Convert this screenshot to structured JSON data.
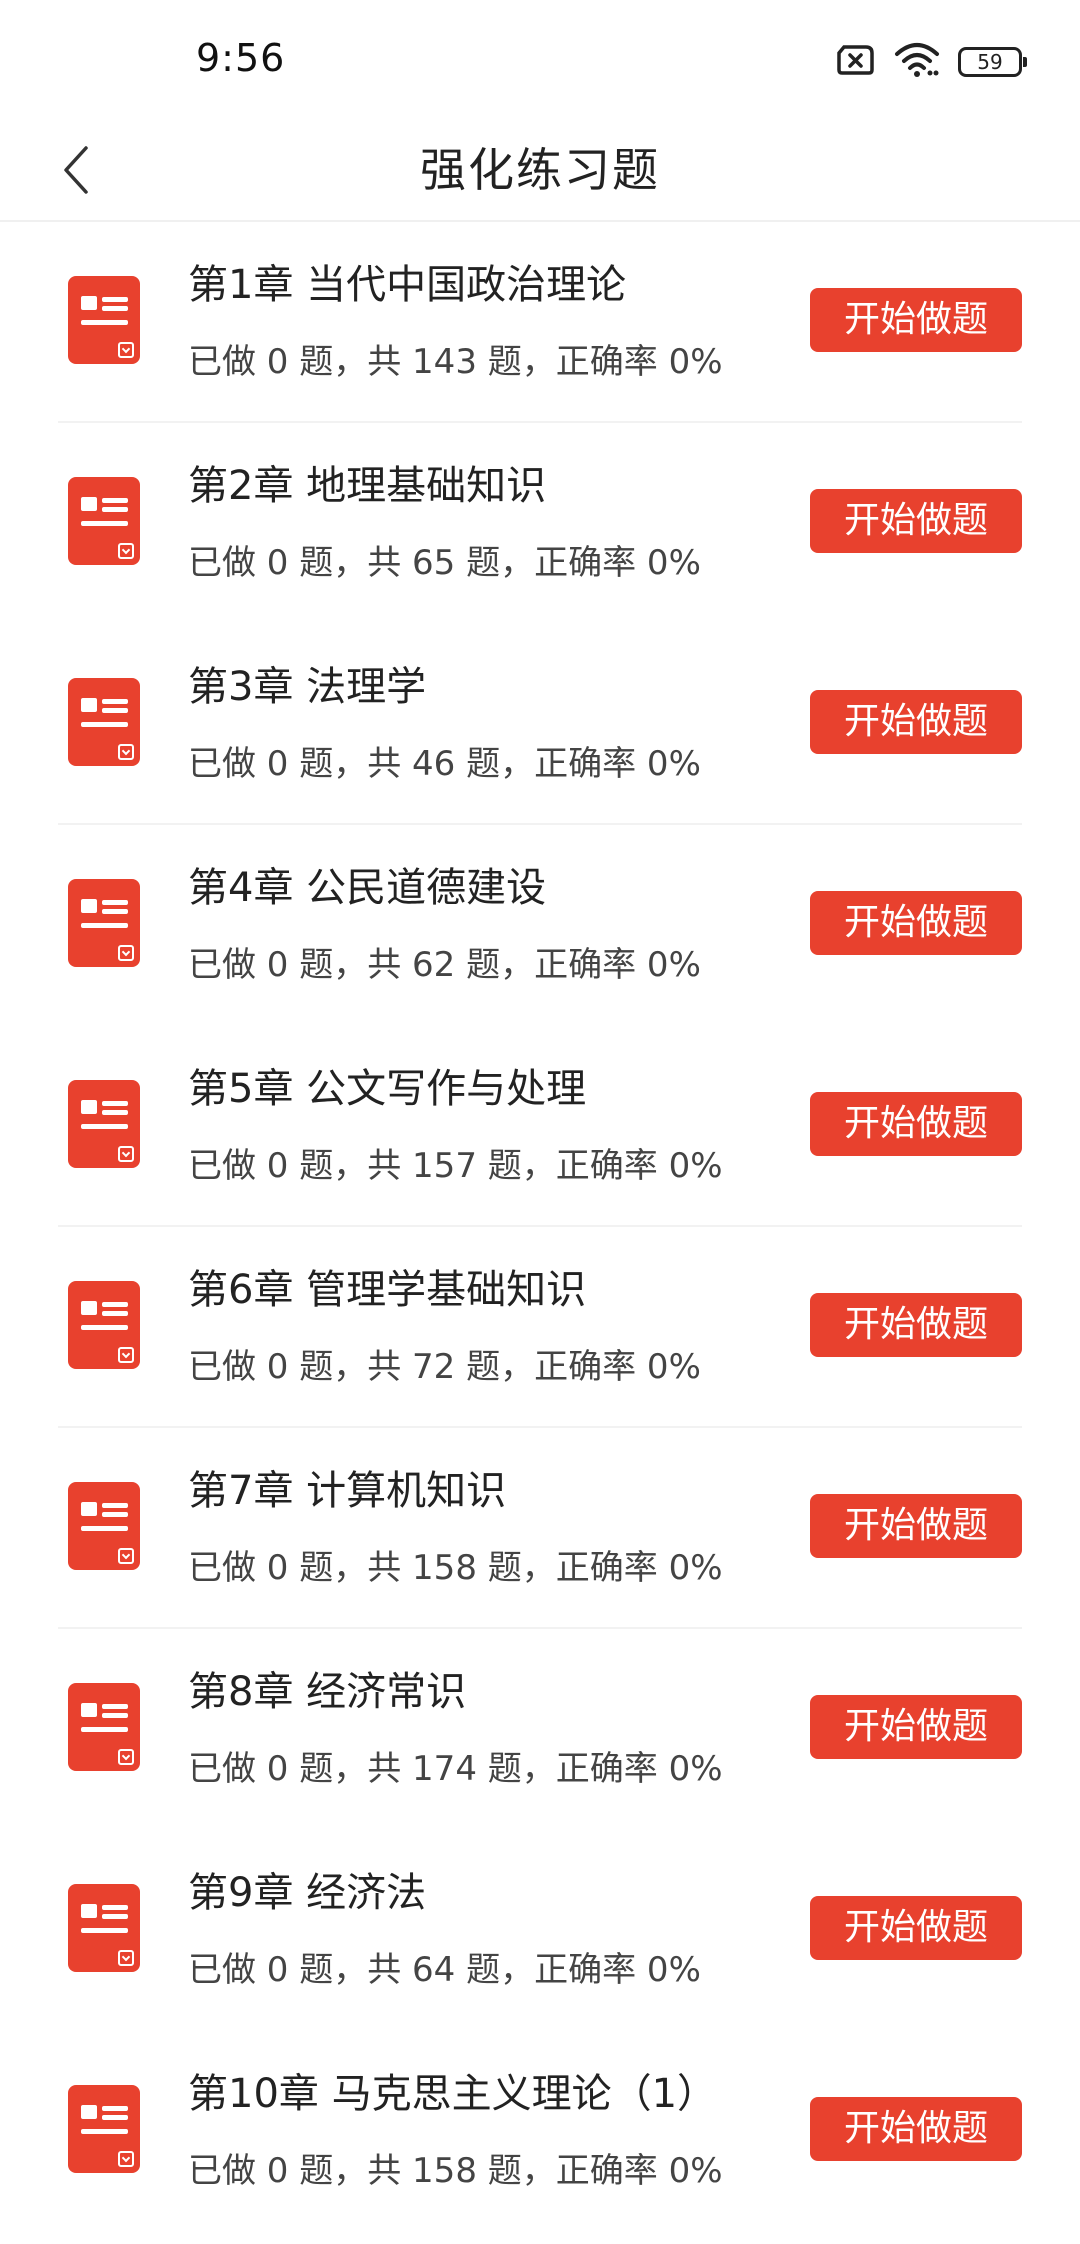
{
  "status_bar": {
    "time": "9:56",
    "battery": "59",
    "icons": [
      "sim-blocked-icon",
      "wifi-icon",
      "battery-icon"
    ]
  },
  "nav": {
    "title": "强化练习题",
    "back_icon": "chevron-left-icon"
  },
  "colors": {
    "accent": "#e8412e",
    "text_primary": "#222222",
    "text_secondary": "#444444",
    "divider": "#f2f2f2"
  },
  "chapters": [
    {
      "title": "第1章 当代中国政治理论",
      "stats": "已做 0 题，共 143 题，正确率 0%",
      "button": "开始做题",
      "divider": true
    },
    {
      "title": "第2章 地理基础知识",
      "stats": "已做 0 题，共 65 题，正确率 0%",
      "button": "开始做题",
      "divider": false
    },
    {
      "title": "第3章 法理学",
      "stats": "已做 0 题，共 46 题，正确率 0%",
      "button": "开始做题",
      "divider": true
    },
    {
      "title": "第4章 公民道德建设",
      "stats": "已做 0 题，共 62 题，正确率 0%",
      "button": "开始做题",
      "divider": false
    },
    {
      "title": "第5章 公文写作与处理",
      "stats": "已做 0 题，共 157 题，正确率 0%",
      "button": "开始做题",
      "divider": true
    },
    {
      "title": "第6章 管理学基础知识",
      "stats": "已做 0 题，共 72 题，正确率 0%",
      "button": "开始做题",
      "divider": true
    },
    {
      "title": "第7章 计算机知识",
      "stats": "已做 0 题，共 158 题，正确率 0%",
      "button": "开始做题",
      "divider": true
    },
    {
      "title": "第8章 经济常识",
      "stats": "已做 0 题，共 174 题，正确率 0%",
      "button": "开始做题",
      "divider": false
    },
    {
      "title": "第9章 经济法",
      "stats": "已做 0 题，共 64 题，正确率 0%",
      "button": "开始做题",
      "divider": false
    },
    {
      "title": "第10章 马克思主义理论（1）",
      "stats": "已做 0 题，共 158 题，正确率 0%",
      "button": "开始做题",
      "divider": false
    }
  ]
}
